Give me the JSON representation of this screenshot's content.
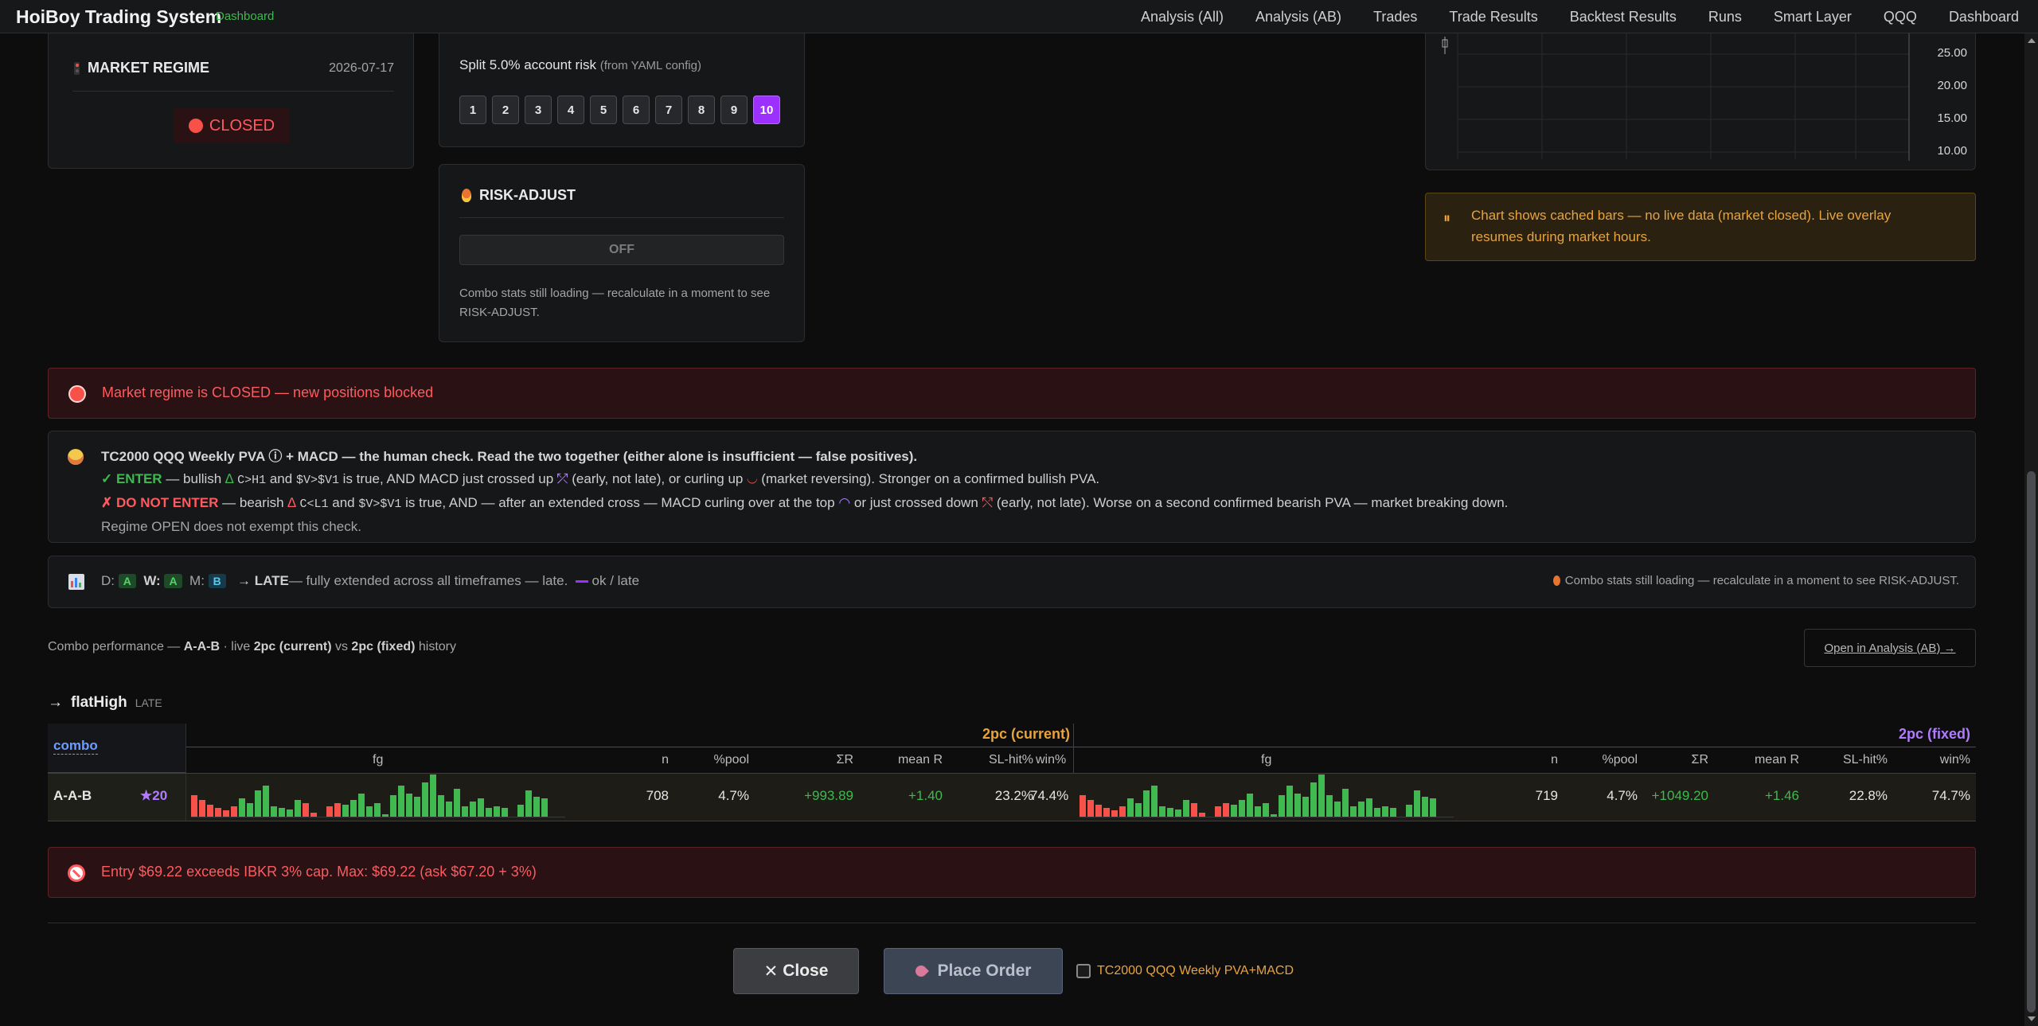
{
  "nav": {
    "brand": "HoiBoy Trading System",
    "brand_sub": "Dashboard",
    "links": [
      "Analysis (All)",
      "Analysis (AB)",
      "Trades",
      "Trade Results",
      "Backtest Results",
      "Runs",
      "Smart Layer",
      "QQQ",
      "Dashboard"
    ]
  },
  "regime": {
    "title": "MARKET REGIME",
    "date": "2026-07-17",
    "status": "CLOSED"
  },
  "split": {
    "label": "Split 5.0% account risk",
    "sub": "(from YAML config)",
    "pages": [
      "1",
      "2",
      "3",
      "4",
      "5",
      "6",
      "7",
      "8",
      "9",
      "10"
    ],
    "active": "10"
  },
  "risk_adjust": {
    "title": "RISK-ADJUST",
    "state": "OFF",
    "note": "Combo stats still loading — recalculate in a moment to see RISK-ADJUST."
  },
  "chart": {
    "y_ticks": [
      "25.00",
      "20.00",
      "15.00",
      "10.00"
    ]
  },
  "chart_notice": {
    "icon": "⏸",
    "text": "Chart shows cached bars — no live data (market closed). Live overlay resumes during market hours."
  },
  "regime_banner": "Market regime is CLOSED — new positions blocked",
  "tc2000": {
    "title": "TC2000 QQQ Weekly PVA ⓘ + MACD — the human check. Read the two together (either alone is insufficient — false positives).",
    "enter_label": "✓ ENTER",
    "enter_pre": " — bullish ",
    "enter_code1": "C>H1",
    "enter_and": " and ",
    "enter_code2": "$V>$V1",
    "enter_mid": " is true, AND MACD just crossed up ",
    "enter_mid2": " (early, not late), or curling up ",
    "enter_end": " (market reversing). Stronger on a confirmed bullish PVA.",
    "donot_label": "✗ DO NOT ENTER",
    "donot_pre": " — bearish ",
    "donot_code1": "C<L1",
    "donot_and": " and ",
    "donot_code2": "$V>$V1",
    "donot_mid": " is true, AND — after an extended cross — MACD curling over at the top ",
    "donot_mid2": " or just crossed down ",
    "donot_end": " (early, not late). Worse on a second confirmed bearish PVA — market breaking down.",
    "footer": "Regime OPEN does not exempt this check."
  },
  "timeframes": {
    "d_label": "D:",
    "d_val": "A",
    "w_label": "W:",
    "w_val": "A",
    "m_label": "M:",
    "m_val": "B",
    "arrow": "→",
    "late": "LATE",
    "late_desc": " — fully extended across all timeframes — late.",
    "legend": "ok / late",
    "right_note": "Combo stats still loading — recalculate in a moment to see RISK-ADJUST."
  },
  "combo_perf": {
    "prefix": "Combo performance — ",
    "combo": "A-A-B",
    "mid": " · live ",
    "current": "2pc (current)",
    "vs": " vs ",
    "fixed": "2pc (fixed)",
    "suffix": " history",
    "open_link": "Open in Analysis (AB) →"
  },
  "section": {
    "arrow": "→",
    "name": "flatHigh",
    "tag": "LATE"
  },
  "table": {
    "combo_header": "combo",
    "current_title": "2pc (current)",
    "fixed_title": "2pc (fixed)",
    "headers": [
      "fg",
      "n",
      "%pool",
      "ΣR",
      "mean R",
      "SL-hit%",
      "win%"
    ],
    "row": {
      "combo": "A-A-B",
      "star": "★20",
      "current": {
        "n": "708",
        "pool": "4.7%",
        "sumR": "+993.89",
        "meanR": "+1.40",
        "sl": "23.2%",
        "win": "74.4%"
      },
      "fixed": {
        "n": "719",
        "pool": "4.7%",
        "sumR": "+1049.20",
        "meanR": "+1.46",
        "sl": "22.8%",
        "win": "74.7%"
      }
    }
  },
  "entry_warning": "Entry $69.22 exceeds IBKR 3% cap. Max: $69.22 (ask $67.20 + 3%)",
  "actions": {
    "close": "Close",
    "place": "Place Order",
    "checkbox_label": "TC2000 QQQ Weekly PVA+MACD"
  },
  "colors": {
    "green": "#3fb950",
    "red": "#f85149",
    "orange": "#e8a33d",
    "purple": "#9b30ff"
  }
}
